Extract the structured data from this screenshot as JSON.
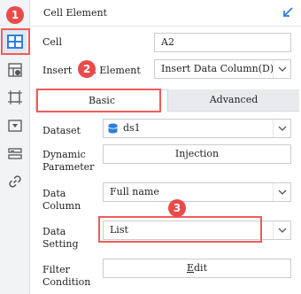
{
  "header": {
    "title": "Cell Element"
  },
  "cell": {
    "label": "Cell",
    "value": "A2"
  },
  "insert": {
    "label_visible": "Insert",
    "label_suffix": "l Element",
    "value": "Insert Data Column(D)"
  },
  "tabs": [
    {
      "label": "Basic"
    },
    {
      "label": "Advanced"
    }
  ],
  "dataset": {
    "label": "Dataset",
    "value": "ds1"
  },
  "dynamic_parameter": {
    "label_line1": "Dynamic",
    "label_line2": "Parameter",
    "button": "Injection"
  },
  "data_column": {
    "label_line1": "Data",
    "label_line2": "Column",
    "value": "Full name"
  },
  "data_setting": {
    "label_line1": "Data",
    "label_line2": "Setting",
    "value": "List"
  },
  "filter_condition": {
    "label_line1": "Filter",
    "label_line2": "Condition",
    "button_prefix": "",
    "button_underlined": "E",
    "button_rest": "dit"
  },
  "badges": [
    "1",
    "2",
    "3"
  ],
  "colors": {
    "accent_blue": "#2f7fd8",
    "highlight_red": "#f05a5a",
    "badge_red": "#e94b4b"
  },
  "rail_icons": [
    "cell-element-icon",
    "cell-attribute-icon",
    "widget-icon",
    "dropdown-icon",
    "layout-icon",
    "link-icon"
  ]
}
